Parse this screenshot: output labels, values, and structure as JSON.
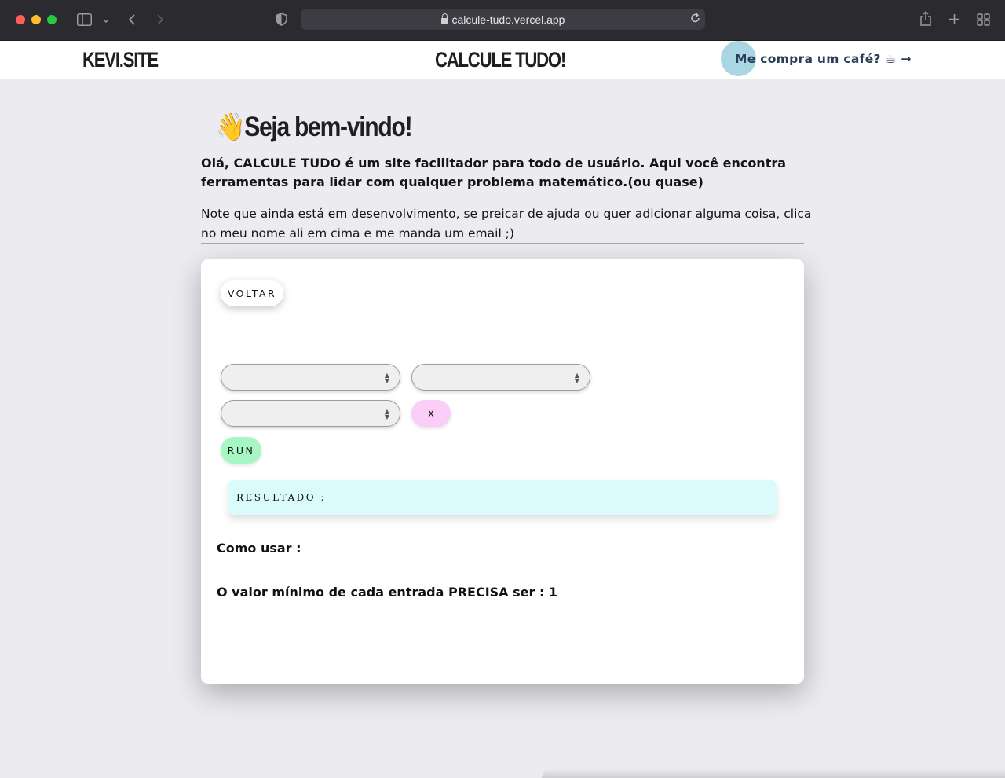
{
  "browser": {
    "url": "calcule-tudo.vercel.app"
  },
  "header": {
    "brand": "KEVI.SITE",
    "title": "CALCULE TUDO!",
    "coffee_link": "Me compra um café? ☕ →"
  },
  "intro": {
    "welcome_emoji": "👋",
    "welcome": "Seja bem-vindo!",
    "description": "Olá, CALCULE TUDO é um site facilitador para todo de usuário. Aqui você encontra ferramentas para lidar com qualquer problema matemático.(ou quase)",
    "note": "Note que ainda está em desenvolvimento, se preicar de ajuda ou quer adicionar alguma coisa, clica no meu nome ali em cima e me manda um email ;)"
  },
  "calculator": {
    "back_label": "VOLTAR",
    "input_1": "",
    "input_2": "",
    "input_3": "",
    "x_label": "x",
    "run_label": "RUN",
    "result_label": "RESULTADO :",
    "howto_label": "Como usar :",
    "min_value_note": "O valor mínimo de cada entrada PRECISA ser : 1"
  }
}
